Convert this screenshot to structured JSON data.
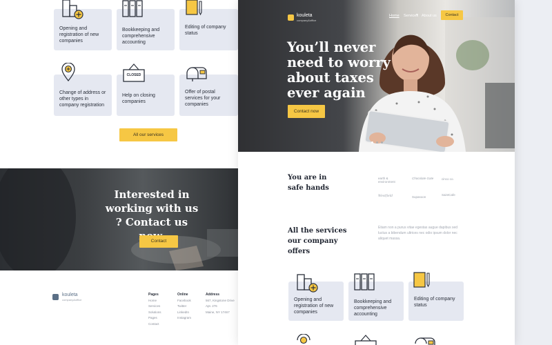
{
  "colors": {
    "accent": "#f6c744",
    "card": "#e5e8f1",
    "dark": "#2a2f3a"
  },
  "left": {
    "services": [
      {
        "label": "Opening and registration of new companies",
        "icon": "building-add-icon"
      },
      {
        "label": "Bookkeeping and comprehensive accounting",
        "icon": "binders-icon"
      },
      {
        "label": "Editing of company status",
        "icon": "document-edit-icon"
      },
      {
        "label": "Change of address or other types in company registration",
        "icon": "location-pin-icon"
      },
      {
        "label": "Help on closing companies",
        "icon": "closed-sign-icon"
      },
      {
        "label": "Offer of postal services for your companies",
        "icon": "mailbox-icon"
      }
    ],
    "closed_sign": "CLOSED",
    "all_services_button": "All our services",
    "contact_heading": "Interested in working with us ? Contact us now.",
    "contact_button": "Contact",
    "footer": {
      "brand": "kouleta",
      "brand_sub": "company&office",
      "pages_title": "Pages",
      "pages": [
        "Home",
        "Services",
        "Solutions",
        "Pages",
        "Contact"
      ],
      "online_title": "Online",
      "online": [
        "Facebook",
        "Twitter",
        "LinkedIn",
        "Instagram"
      ],
      "address_title": "Address",
      "address": [
        "567, Kingstone Drive",
        "Apt. 276",
        "Maine, NY 17467"
      ]
    }
  },
  "right": {
    "brand": "kouleta",
    "brand_sub": "company&office",
    "nav": [
      "Home",
      "Services",
      "About us"
    ],
    "nav_contact": "Contact",
    "hero_title": "You’ll never need to worry about taxes ever again",
    "hero_button": "Contact now",
    "safe_title": "You are in safe hands",
    "partner_logos": [
      "earth & environment",
      "Chocolate Gate",
      "cinco co.",
      "Westfield",
      "Supasoon",
      "SaintCafe"
    ],
    "services_title": "All the services our company offers",
    "services_text": "Etiam non a purus vitae egestas augue dapibus sed luctus a bibendum ultrices nec odio ipsum dolor nec aliquet massa.",
    "services": [
      {
        "label": "Opening and registration of new companies",
        "icon": "building-add-icon"
      },
      {
        "label": "Bookkeeping and comprehensive accounting",
        "icon": "binders-icon"
      },
      {
        "label": "Editing of company status",
        "icon": "document-edit-icon"
      }
    ]
  }
}
